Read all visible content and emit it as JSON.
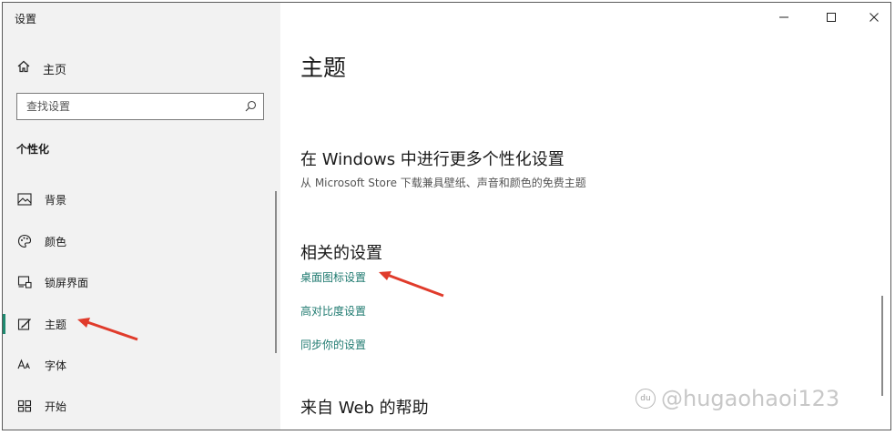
{
  "window": {
    "title": "设置",
    "controls": [
      "minimize-icon",
      "maximize-icon",
      "close-icon"
    ]
  },
  "sidebar": {
    "home_label": "主页",
    "home_icon": "home-icon",
    "search_placeholder": "查找设置",
    "search_icon": "search-icon",
    "section_label": "个性化",
    "items": [
      {
        "label": "背景",
        "icon": "picture-icon",
        "selected": false
      },
      {
        "label": "颜色",
        "icon": "palette-icon",
        "selected": false
      },
      {
        "label": "锁屏界面",
        "icon": "lock-screen-icon",
        "selected": false
      },
      {
        "label": "主题",
        "icon": "brush-icon",
        "selected": true
      },
      {
        "label": "字体",
        "icon": "font-icon",
        "selected": false
      },
      {
        "label": "开始",
        "icon": "start-icon",
        "selected": false
      }
    ]
  },
  "main": {
    "title": "主题",
    "store_heading": "在 Windows 中进行更多个性化设置",
    "store_sub": "从 Microsoft Store 下载兼具壁纸、声音和颜色的免费主题",
    "related_heading": "相关的设置",
    "related_links": [
      "桌面图标设置",
      "高对比度设置",
      "同步你的设置"
    ],
    "help_heading": "来自 Web 的帮助"
  },
  "watermark": {
    "logo": "du",
    "text": "@hugaohaoi123"
  },
  "colors": {
    "accent": "#1f8a70",
    "link": "#1f7a70",
    "arrow": "#e03b2b",
    "sidebar_bg": "#f2f2f2"
  }
}
